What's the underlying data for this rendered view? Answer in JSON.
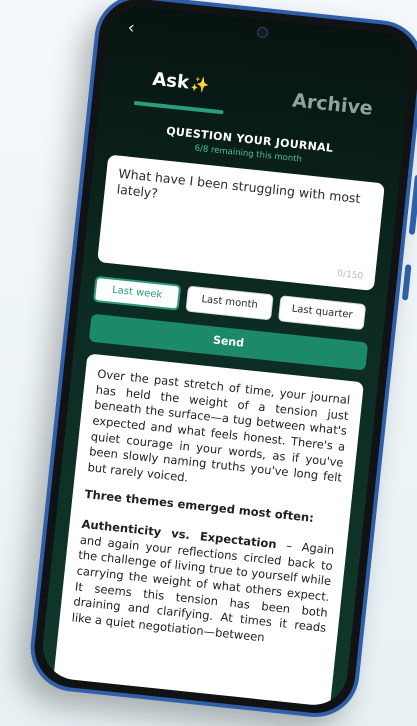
{
  "header": {
    "back_icon": "back-chevron-icon",
    "back_glyph": "‹"
  },
  "tabs": [
    {
      "label": "Ask",
      "icon": "sparkle-icon",
      "icon_glyph": "✨",
      "active": true
    },
    {
      "label": "Archive",
      "active": false
    }
  ],
  "section": {
    "title": "QUESTION YOUR JOURNAL",
    "remaining": "6/8 remaining this month"
  },
  "question": {
    "text": "What have I been struggling with most lately?",
    "counter": "0/150"
  },
  "time_ranges": [
    {
      "label": "Last week",
      "active": true
    },
    {
      "label": "Last month",
      "active": false
    },
    {
      "label": "Last quarter",
      "active": false
    }
  ],
  "send_label": "Send",
  "answer": {
    "intro": "Over the past stretch of time, your journal has held the weight of a tension just beneath the surface—a tug between what's expected and what feels honest. There's a quiet courage in your words, as if you've been slowly naming truths you've long felt but rarely voiced.",
    "themes_heading": "Three themes emerged most often:",
    "theme1_name": "Authenticity vs. Expectation",
    "theme1_body": " – Again and again your reflections circled back to the challenge of living true to yourself while carrying the weight of what others expect. It seems this tension has been both draining and clarifying. At times it reads like a quiet negotiation—between"
  },
  "colors": {
    "accent": "#2a9d7e",
    "accent_text": "#3fc49c",
    "send": "#1c8a6a",
    "screen_bg": "#0c2a22",
    "frame": "#2f5fa8"
  }
}
